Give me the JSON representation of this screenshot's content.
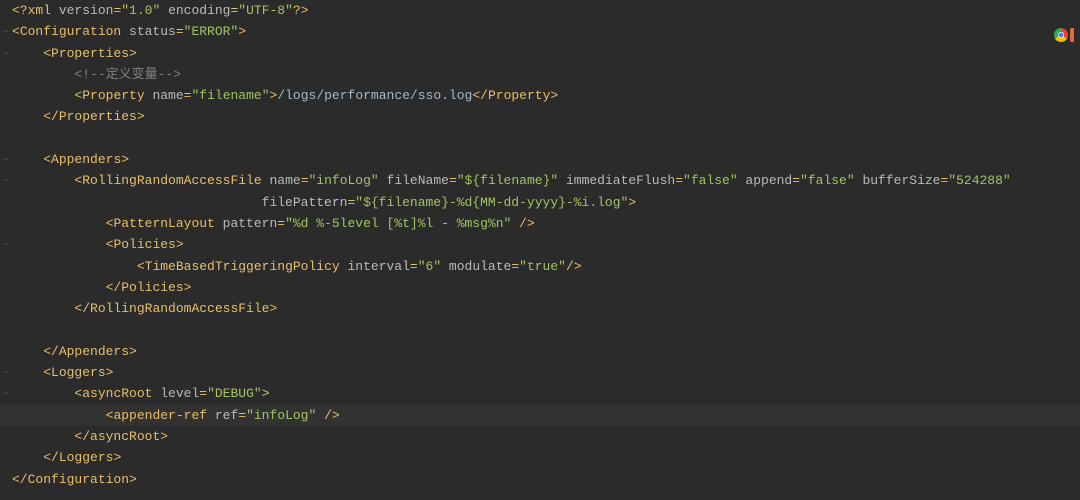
{
  "highlight_line_index": 19,
  "lines": [
    {
      "indent": 0,
      "segs": [
        {
          "c": "pi",
          "t": "<?"
        },
        {
          "c": "tag",
          "t": "xml "
        },
        {
          "c": "attr",
          "t": "version"
        },
        {
          "c": "punc",
          "t": "="
        },
        {
          "c": "val",
          "t": "\"1.0\""
        },
        {
          "c": "attr",
          "t": " encoding"
        },
        {
          "c": "punc",
          "t": "="
        },
        {
          "c": "val",
          "t": "\"UTF-8\""
        },
        {
          "c": "pi",
          "t": "?>"
        }
      ]
    },
    {
      "indent": 0,
      "segs": [
        {
          "c": "punc",
          "t": "<"
        },
        {
          "c": "tag",
          "t": "Configuration "
        },
        {
          "c": "attr",
          "t": "status"
        },
        {
          "c": "punc",
          "t": "="
        },
        {
          "c": "val",
          "t": "\"ERROR\""
        },
        {
          "c": "punc",
          "t": ">"
        }
      ]
    },
    {
      "indent": 1,
      "segs": [
        {
          "c": "punc",
          "t": "<"
        },
        {
          "c": "tag",
          "t": "Properties"
        },
        {
          "c": "punc",
          "t": ">"
        }
      ]
    },
    {
      "indent": 2,
      "segs": [
        {
          "c": "comment",
          "t": "<!--定义变量-->"
        }
      ]
    },
    {
      "indent": 2,
      "segs": [
        {
          "c": "punc",
          "t": "<"
        },
        {
          "c": "tag",
          "t": "Property "
        },
        {
          "c": "attr",
          "t": "name"
        },
        {
          "c": "punc",
          "t": "="
        },
        {
          "c": "val",
          "t": "\"filename\""
        },
        {
          "c": "punc",
          "t": ">"
        },
        {
          "c": "txt",
          "t": "/logs/performance/sso.log"
        },
        {
          "c": "punc",
          "t": "</"
        },
        {
          "c": "tag",
          "t": "Property"
        },
        {
          "c": "punc",
          "t": ">"
        }
      ]
    },
    {
      "indent": 1,
      "segs": [
        {
          "c": "punc",
          "t": "</"
        },
        {
          "c": "tag",
          "t": "Properties"
        },
        {
          "c": "punc",
          "t": ">"
        }
      ]
    },
    {
      "indent": 0,
      "segs": []
    },
    {
      "indent": 1,
      "segs": [
        {
          "c": "punc",
          "t": "<"
        },
        {
          "c": "tag",
          "t": "Appenders"
        },
        {
          "c": "punc",
          "t": ">"
        }
      ]
    },
    {
      "indent": 2,
      "segs": [
        {
          "c": "punc",
          "t": "<"
        },
        {
          "c": "tag",
          "t": "RollingRandomAccessFile "
        },
        {
          "c": "attr",
          "t": "name"
        },
        {
          "c": "punc",
          "t": "="
        },
        {
          "c": "val",
          "t": "\"infoLog\""
        },
        {
          "c": "attr",
          "t": " fileName"
        },
        {
          "c": "punc",
          "t": "="
        },
        {
          "c": "val",
          "t": "\"${filename}\""
        },
        {
          "c": "attr",
          "t": " immediateFlush"
        },
        {
          "c": "punc",
          "t": "="
        },
        {
          "c": "val",
          "t": "\"false\""
        },
        {
          "c": "attr",
          "t": " append"
        },
        {
          "c": "punc",
          "t": "="
        },
        {
          "c": "val",
          "t": "\"false\""
        },
        {
          "c": "attr",
          "t": " bufferSize"
        },
        {
          "c": "punc",
          "t": "="
        },
        {
          "c": "val",
          "t": "\"524288\""
        }
      ]
    },
    {
      "indent": 8,
      "segs": [
        {
          "c": "attr",
          "t": "filePattern"
        },
        {
          "c": "punc",
          "t": "="
        },
        {
          "c": "val",
          "t": "\"${filename}-%d{MM-dd-yyyy}-%i.log\""
        },
        {
          "c": "punc",
          "t": ">"
        }
      ]
    },
    {
      "indent": 3,
      "segs": [
        {
          "c": "punc",
          "t": "<"
        },
        {
          "c": "tag",
          "t": "PatternLayout "
        },
        {
          "c": "attr",
          "t": "pattern"
        },
        {
          "c": "punc",
          "t": "="
        },
        {
          "c": "val",
          "t": "\"%d %-5level [%t]%l - %msg%n\""
        },
        {
          "c": "punc",
          "t": " />"
        }
      ]
    },
    {
      "indent": 3,
      "segs": [
        {
          "c": "punc",
          "t": "<"
        },
        {
          "c": "tag",
          "t": "Policies"
        },
        {
          "c": "punc",
          "t": ">"
        }
      ]
    },
    {
      "indent": 4,
      "segs": [
        {
          "c": "punc",
          "t": "<"
        },
        {
          "c": "tag",
          "t": "TimeBasedTriggeringPolicy "
        },
        {
          "c": "attr",
          "t": "interval"
        },
        {
          "c": "punc",
          "t": "="
        },
        {
          "c": "val",
          "t": "\"6\""
        },
        {
          "c": "attr",
          "t": " modulate"
        },
        {
          "c": "punc",
          "t": "="
        },
        {
          "c": "val",
          "t": "\"true\""
        },
        {
          "c": "punc",
          "t": "/>"
        }
      ]
    },
    {
      "indent": 3,
      "segs": [
        {
          "c": "punc",
          "t": "</"
        },
        {
          "c": "tag",
          "t": "Policies"
        },
        {
          "c": "punc",
          "t": ">"
        }
      ]
    },
    {
      "indent": 2,
      "segs": [
        {
          "c": "punc",
          "t": "</"
        },
        {
          "c": "tag",
          "t": "RollingRandomAccessFile"
        },
        {
          "c": "punc",
          "t": ">"
        }
      ]
    },
    {
      "indent": 0,
      "segs": []
    },
    {
      "indent": 1,
      "segs": [
        {
          "c": "punc",
          "t": "</"
        },
        {
          "c": "tag",
          "t": "Appenders"
        },
        {
          "c": "punc",
          "t": ">"
        }
      ]
    },
    {
      "indent": 1,
      "segs": [
        {
          "c": "punc",
          "t": "<"
        },
        {
          "c": "tag",
          "t": "Loggers"
        },
        {
          "c": "punc",
          "t": ">"
        }
      ]
    },
    {
      "indent": 2,
      "segs": [
        {
          "c": "punc",
          "t": "<"
        },
        {
          "c": "tag",
          "t": "asyncRoot "
        },
        {
          "c": "attr",
          "t": "level"
        },
        {
          "c": "punc",
          "t": "="
        },
        {
          "c": "val",
          "t": "\"DEBUG\""
        },
        {
          "c": "punc",
          "t": ">"
        }
      ]
    },
    {
      "indent": 3,
      "segs": [
        {
          "c": "punc",
          "t": "<"
        },
        {
          "c": "tag",
          "t": "appender-ref "
        },
        {
          "c": "attr",
          "t": "ref"
        },
        {
          "c": "punc",
          "t": "="
        },
        {
          "c": "val",
          "t": "\"infoLog\""
        },
        {
          "c": "punc",
          "t": " />"
        }
      ]
    },
    {
      "indent": 2,
      "segs": [
        {
          "c": "punc",
          "t": "</"
        },
        {
          "c": "tag",
          "t": "asyncRoot"
        },
        {
          "c": "punc",
          "t": ">"
        }
      ]
    },
    {
      "indent": 1,
      "segs": [
        {
          "c": "punc",
          "t": "</"
        },
        {
          "c": "tag",
          "t": "Loggers"
        },
        {
          "c": "punc",
          "t": ">"
        }
      ]
    },
    {
      "indent": 0,
      "segs": [
        {
          "c": "punc",
          "t": "</"
        },
        {
          "c": "tag",
          "t": "Configuration"
        },
        {
          "c": "punc",
          "t": ">"
        }
      ]
    }
  ],
  "fold_markers": [
    1,
    2,
    7,
    8,
    11,
    17,
    18
  ],
  "indent_unit": "    "
}
